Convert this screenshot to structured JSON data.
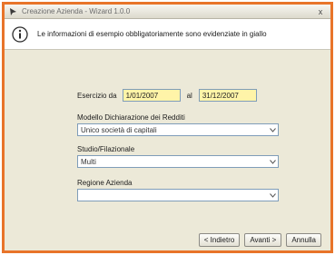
{
  "window": {
    "title": "Creazione Azienda - Wizard 1.0.0",
    "close_glyph": "x"
  },
  "header": {
    "info_text": "Le informazioni di esempio obbligatoriamente sono evidenziate in giallo"
  },
  "form": {
    "exercise_label": "Esercizio da",
    "date_from": "1/01/2007",
    "date_sep": "al",
    "date_to": "31/12/2007",
    "model_label": "Modello Dichiarazione dei Redditi",
    "model_value": "Unico società di capitali",
    "studio_label": "Studio/Filazionale",
    "studio_value": "Multi",
    "region_label": "Regione Azienda",
    "region_value": ""
  },
  "buttons": {
    "back": "< Indietro",
    "next": "Avanti >",
    "cancel": "Annulla"
  },
  "colors": {
    "accent_border": "#e8742a",
    "required_field": "#fff4a8"
  }
}
